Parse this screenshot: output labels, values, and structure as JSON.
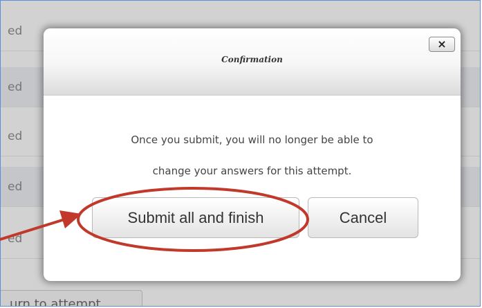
{
  "background": {
    "row_text": "ed",
    "return_button_label": "urn to attempt"
  },
  "dialog": {
    "title": "Confirmation",
    "close_label": "×",
    "message_line1": "Once you submit, you will no longer be able to",
    "message_line2": "change your answers for this attempt.",
    "submit_label": "Submit all and finish",
    "cancel_label": "Cancel"
  },
  "annotation": {
    "color": "#c0392b"
  }
}
